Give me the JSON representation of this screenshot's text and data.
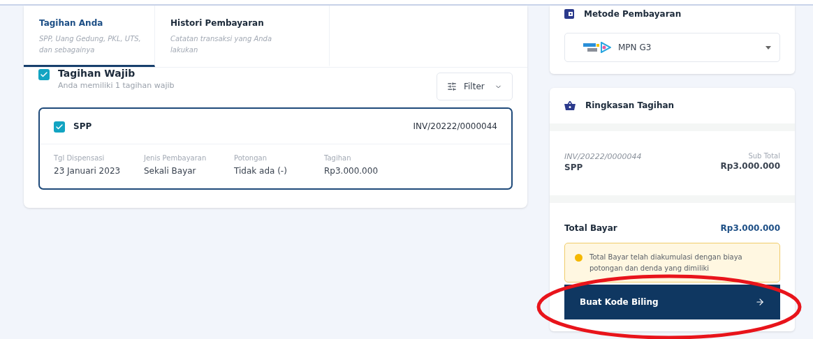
{
  "tabs": [
    {
      "label": "Tagihan Anda",
      "hint": "SPP, Uang Gedung, PKL, UTS, dan sebagainya",
      "selected": true
    },
    {
      "label": "Histori Pembayaran",
      "hint": "Catatan transaksi yang Anda lakukan",
      "selected": false
    }
  ],
  "section": {
    "title": "Tagihan Wajib",
    "subtitle": "Anda memiliki 1 tagihan wajib",
    "checked": true,
    "filter": "Filter"
  },
  "bills": [
    {
      "name": "SPP",
      "invoice": "INV/20222/0000044",
      "checked": true,
      "fields": [
        {
          "label": "Tgl Dispensasi",
          "value": "23 Januari 2023"
        },
        {
          "label": "Jenis Pembayaran",
          "value": "Sekali Bayar"
        },
        {
          "label": "Potongan",
          "value": "Tidak ada (-)"
        },
        {
          "label": "Tagihan",
          "value": "Rp3.000.000"
        }
      ]
    }
  ],
  "payment_method": {
    "title": "Metode Pembayaran",
    "value": "MPN G3"
  },
  "summary": {
    "title": "Ringkasan Tagihan",
    "items": [
      {
        "invoice": "INV/20222/0000044",
        "name": "SPP",
        "subtotal_label": "Sub Total",
        "subtotal": "Rp3.000.000"
      }
    ],
    "total_label": "Total Bayar",
    "total": "Rp3.000.000",
    "notice": "Total Bayar telah diakumulasi dengan biaya potongan dan denda yang dimiliki",
    "button": "Buat Kode Biling"
  },
  "annotation": {
    "kind": "ellipse",
    "color": "#e8141b"
  }
}
